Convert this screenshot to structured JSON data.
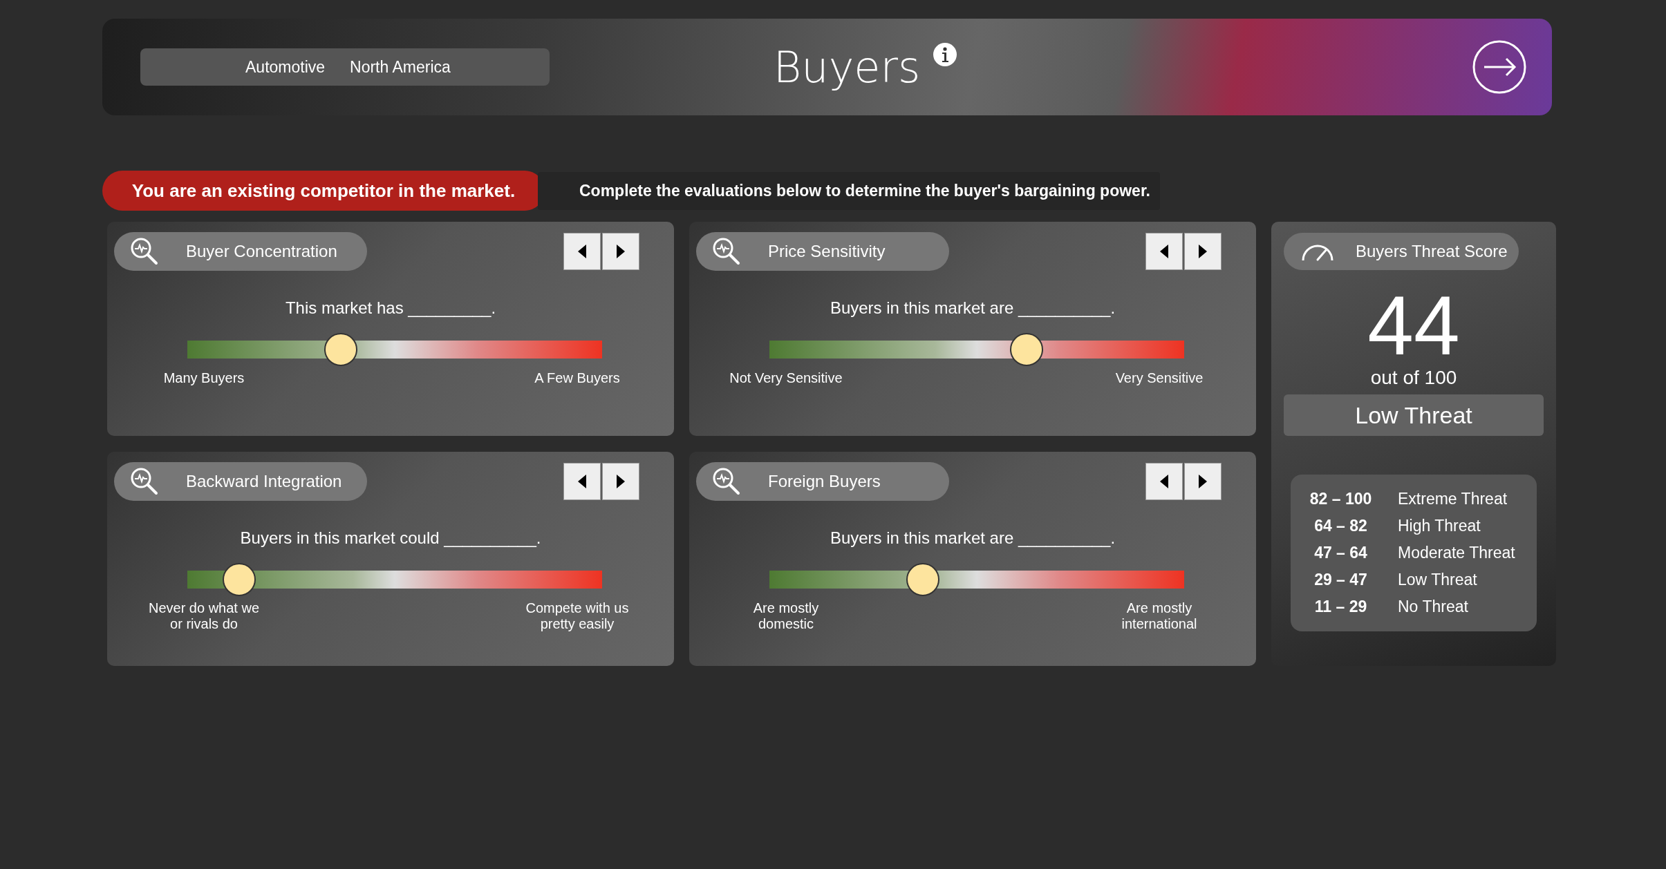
{
  "header": {
    "industry": "Automotive",
    "region": "North America",
    "title": "Buyers"
  },
  "status_banner": "You are an existing competitor in the market.",
  "instruction": "Complete the evaluations below to determine the buyer's bargaining power.",
  "evaluations": [
    {
      "title": "Buyer Concentration",
      "prompt": "This market has _________.",
      "level": 0.37,
      "low_label": "Many Buyers",
      "high_label": "A Few Buyers"
    },
    {
      "title": "Price Sensitivity",
      "prompt": "Buyers in this market are __________.",
      "level": 0.62,
      "low_label": "Not Very Sensitive",
      "high_label": "Very Sensitive"
    },
    {
      "title": "Backward Integration",
      "prompt": "Buyers in this market could __________.",
      "level": 0.125,
      "low_label": "Never do what we or rivals do",
      "high_label": "Compete with us pretty easily"
    },
    {
      "title": "Foreign Buyers",
      "prompt": "Buyers in this market are __________.",
      "level": 0.37,
      "low_label": "Are mostly domestic",
      "high_label": "Are mostly international"
    }
  ],
  "score": {
    "title": "Buyers Threat Score",
    "value": "44",
    "out_of": "out of 100",
    "rating": "Low Threat",
    "legend": [
      {
        "range": "82 – 100",
        "label": "Extreme Threat"
      },
      {
        "range": "64 – 82",
        "label": "High Threat"
      },
      {
        "range": "47 – 64",
        "label": "Moderate Threat"
      },
      {
        "range": "29 – 47",
        "label": "Low Threat"
      },
      {
        "range": "11 – 29",
        "label": "No Threat"
      }
    ]
  }
}
